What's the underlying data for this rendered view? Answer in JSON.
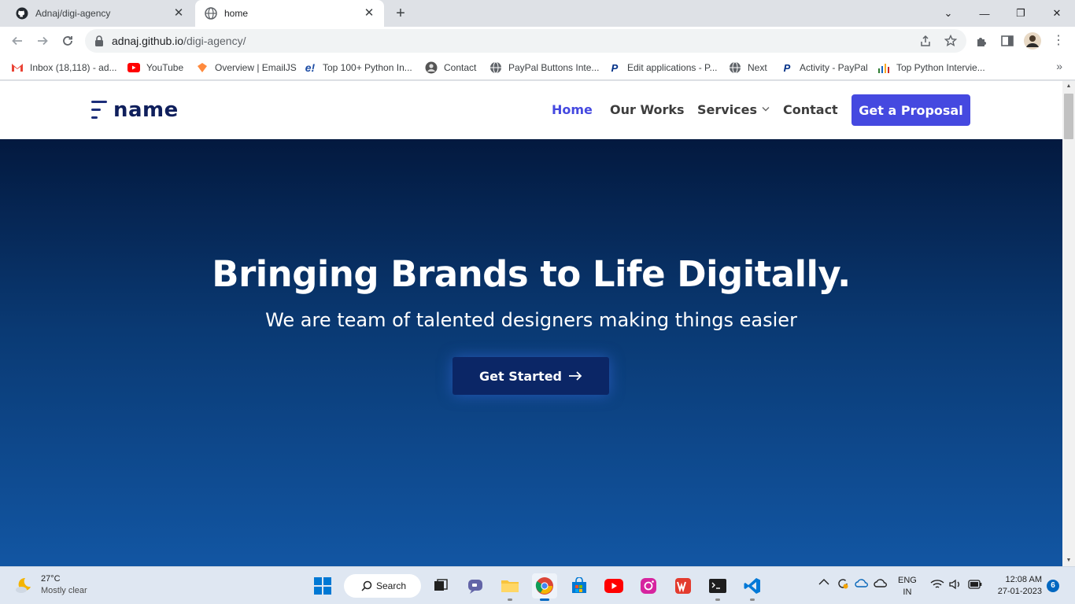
{
  "browser": {
    "tabs": [
      {
        "title": "Adnaj/digi-agency",
        "icon": "github-icon",
        "active": false
      },
      {
        "title": "home",
        "icon": "globe-icon",
        "active": true
      }
    ],
    "url_host": "adnaj.github.io",
    "url_path": "/digi-agency/",
    "bookmarks": [
      {
        "label": "Inbox (18,118) - ad...",
        "icon": "gmail-icon"
      },
      {
        "label": "YouTube",
        "icon": "youtube-icon"
      },
      {
        "label": "Overview | EmailJS",
        "icon": "emailjs-icon"
      },
      {
        "label": "Top 100+ Python In...",
        "icon": "edureka-icon"
      },
      {
        "label": "Contact",
        "icon": "avatar-icon"
      },
      {
        "label": "PayPal Buttons Inte...",
        "icon": "globe-icon"
      },
      {
        "label": "Edit applications - P...",
        "icon": "paypal-icon"
      },
      {
        "label": "Next",
        "icon": "globe-icon"
      },
      {
        "label": "Activity - PayPal",
        "icon": "paypal-icon"
      },
      {
        "label": "Top Python Intervie...",
        "icon": "chart-icon"
      }
    ]
  },
  "site": {
    "logo_text": "name",
    "nav": {
      "home": "Home",
      "works": "Our Works",
      "services": "Services",
      "contact": "Contact",
      "proposal": "Get a Proposal"
    },
    "hero": {
      "title": "Bringing Brands to Life Digitally.",
      "subtitle": "We are team of talented designers making things easier",
      "cta": "Get Started"
    }
  },
  "taskbar": {
    "weather_temp": "27°C",
    "weather_cond": "Mostly clear",
    "search_label": "Search",
    "lang_1": "ENG",
    "lang_2": "IN",
    "time": "12:08 AM",
    "date": "27-01-2023",
    "notification_count": "6"
  },
  "colors": {
    "accent": "#4549e0",
    "logo": "#0f1f5c",
    "hero_top": "#03193f",
    "hero_bottom": "#1256a3",
    "cta_bg": "#0b2666"
  }
}
